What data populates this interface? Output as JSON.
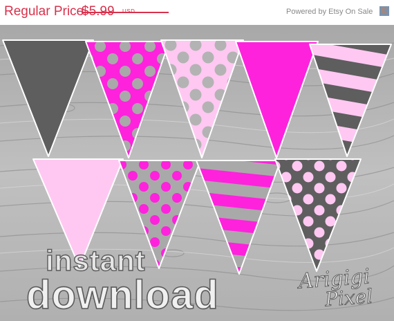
{
  "listing": {
    "price_label": "Regular Price",
    "price_value": "$5.99",
    "currency": "USD",
    "powered_by": "Powered by Etsy On Sale",
    "etsy_badge": "E"
  },
  "image": {
    "line1": "instant",
    "line2": "download",
    "brand_line1": "Arigigi",
    "brand_line2": "Pixel"
  },
  "colors": {
    "sale_red": "#d8314b",
    "hot_pink": "#ff22dd",
    "light_pink": "#ffc8f2",
    "dark_gray": "#5e5e5e",
    "mid_gray": "#a9a9a9",
    "wood_gray": "#b5b5b5"
  }
}
